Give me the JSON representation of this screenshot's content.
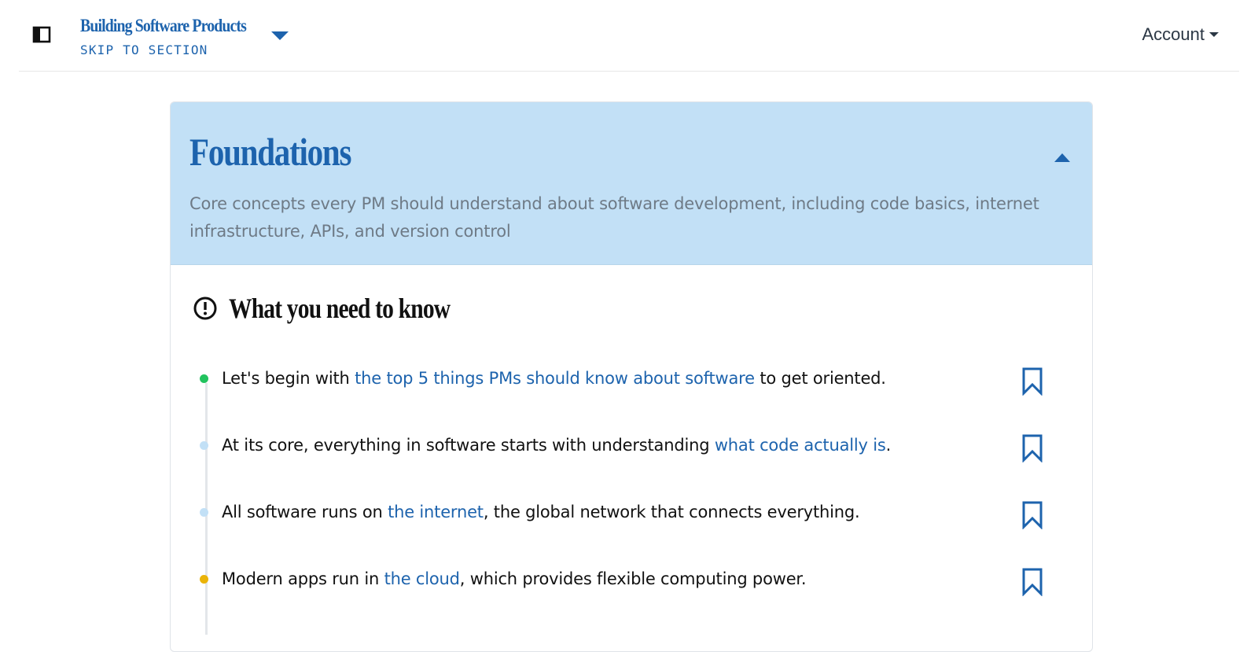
{
  "header": {
    "course_title": "Building Software Products",
    "skip_label": "SKIP TO SECTION",
    "account_label": "Account"
  },
  "section": {
    "title": "Foundations",
    "description": "Core concepts every PM should understand about software development, including code basics, internet infrastructure, APIs, and version control",
    "color_header_bg": "#c2e0f6",
    "color_accent": "#1d63ad"
  },
  "need_to_know": {
    "heading": "What you need to know",
    "items": [
      {
        "before": "Let's begin with ",
        "link": "the top 5 things PMs should know about software",
        "after": " to get oriented.",
        "dot_color": "#22c35e"
      },
      {
        "before": "At its core, everything in software starts with understanding ",
        "link": "what code actually is",
        "after": ".",
        "dot_color": "#c2e0f6"
      },
      {
        "before": "All software runs on ",
        "link": "the internet",
        "after": ", the global network that connects everything.",
        "dot_color": "#c2e0f6"
      },
      {
        "before": "Modern apps run in ",
        "link": "the cloud",
        "after": ", which provides flexible computing power.",
        "dot_color": "#eab308"
      }
    ]
  },
  "icons": {
    "sidebar_toggle": "sidebar-toggle-icon",
    "course_dropdown": "caret-down-icon",
    "collapse": "caret-up-icon",
    "alert": "alert-circle-icon",
    "bookmark": "bookmark-icon"
  }
}
